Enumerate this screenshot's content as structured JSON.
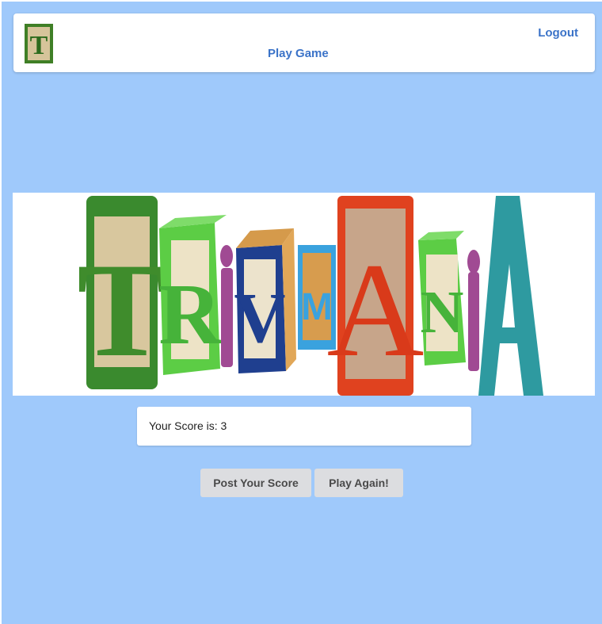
{
  "nav": {
    "logo_letter": "T",
    "logout_label": "Logout",
    "play_label": "Play Game"
  },
  "banner": {
    "title_letters": [
      "T",
      "R",
      "i",
      "V",
      "M",
      "A",
      "N",
      "i",
      "A"
    ],
    "colors": {
      "green_block": "#3a8a2e",
      "bright_green": "#5ccd45",
      "purple": "#a04a93",
      "navy": "#1f3f8f",
      "sky": "#3aa2de",
      "red": "#e0421f",
      "teal": "#2e9aa0"
    }
  },
  "score": {
    "text": "Your Score is: 3"
  },
  "buttons": {
    "post_label": "Post Your Score",
    "again_label": "Play Again!"
  },
  "colors": {
    "background": "#9fc9fb",
    "link": "#3b73c8",
    "button": "#dcdde0"
  }
}
